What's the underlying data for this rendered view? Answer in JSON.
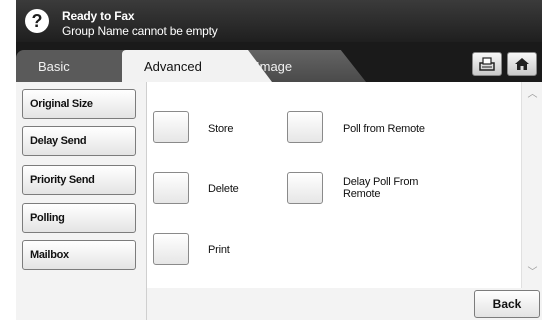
{
  "status": {
    "help_icon": "?",
    "title": "Ready to Fax",
    "message": "Group Name cannot be empty"
  },
  "tabs": [
    {
      "label": "Basic",
      "active": false
    },
    {
      "label": "Advanced",
      "active": true
    },
    {
      "label": "Image",
      "active": false
    }
  ],
  "toolbar": {
    "tray_icon": "tray-icon",
    "home_icon": "home-icon"
  },
  "sidebar": {
    "items": [
      {
        "label": "Original Size"
      },
      {
        "label": "Delay Send"
      },
      {
        "label": "Priority Send"
      },
      {
        "label": "Polling"
      },
      {
        "label": "Mailbox"
      }
    ]
  },
  "options": {
    "store": "Store",
    "delete": "Delete",
    "print": "Print",
    "poll_from_remote": "Poll from Remote",
    "delay_poll_line1": "Delay Poll From",
    "delay_poll_line2": "Remote"
  },
  "footer": {
    "back_label": "Back"
  }
}
